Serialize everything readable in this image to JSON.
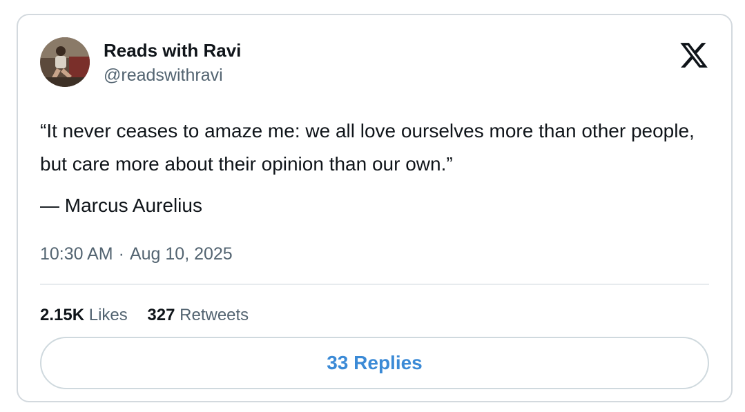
{
  "author": {
    "display_name": "Reads with Ravi",
    "handle": "@readswithravi",
    "avatar_icon": "user-avatar"
  },
  "brand": {
    "logo_icon": "x-logo-icon"
  },
  "tweet": {
    "quote": "“It never ceases to amaze me: we all love ourselves more than other people, but care more about their opinion than our own.”",
    "attribution": "— Marcus Aurelius",
    "time": "10:30 AM",
    "separator": "·",
    "date": "Aug 10, 2025"
  },
  "stats": {
    "likes_count": "2.15K",
    "likes_label": "Likes",
    "retweets_count": "327",
    "retweets_label": "Retweets"
  },
  "replies_button": {
    "label": "33 Replies"
  },
  "colors": {
    "text_primary": "#0f1419",
    "text_secondary": "#536471",
    "accent": "#3b8ad6",
    "border": "#d3d9de"
  }
}
